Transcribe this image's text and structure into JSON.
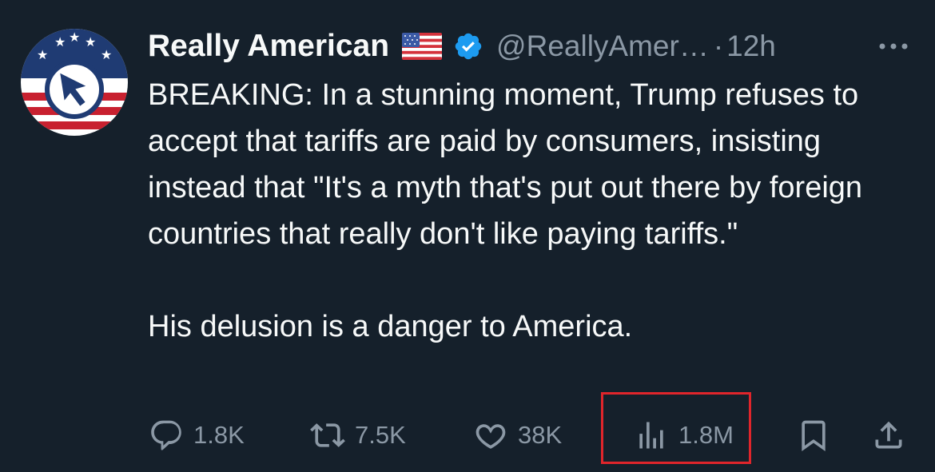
{
  "tweet": {
    "author_name": "Really American",
    "flag_emoji": "us-flag",
    "verified": "verified-badge-icon",
    "handle": "@ReallyAmer…",
    "separator": "·",
    "time": "12h",
    "text_paragraph_1": "BREAKING: In a stunning moment, Trump refuses to accept that tariffs are paid by consumers, insisting instead that \"It's a myth that's put out there by foreign countries that really don't like paying tariffs.\"",
    "text_paragraph_2": "His delusion is a danger to America."
  },
  "actions": {
    "replies": "1.8K",
    "reposts": "7.5K",
    "likes": "38K",
    "views": "1.8M"
  },
  "colors": {
    "background": "#15202b",
    "text": "#f7f9f9",
    "muted": "#8b98a5",
    "verified_blue": "#1d9bf0",
    "highlight_red": "#e0252b"
  }
}
